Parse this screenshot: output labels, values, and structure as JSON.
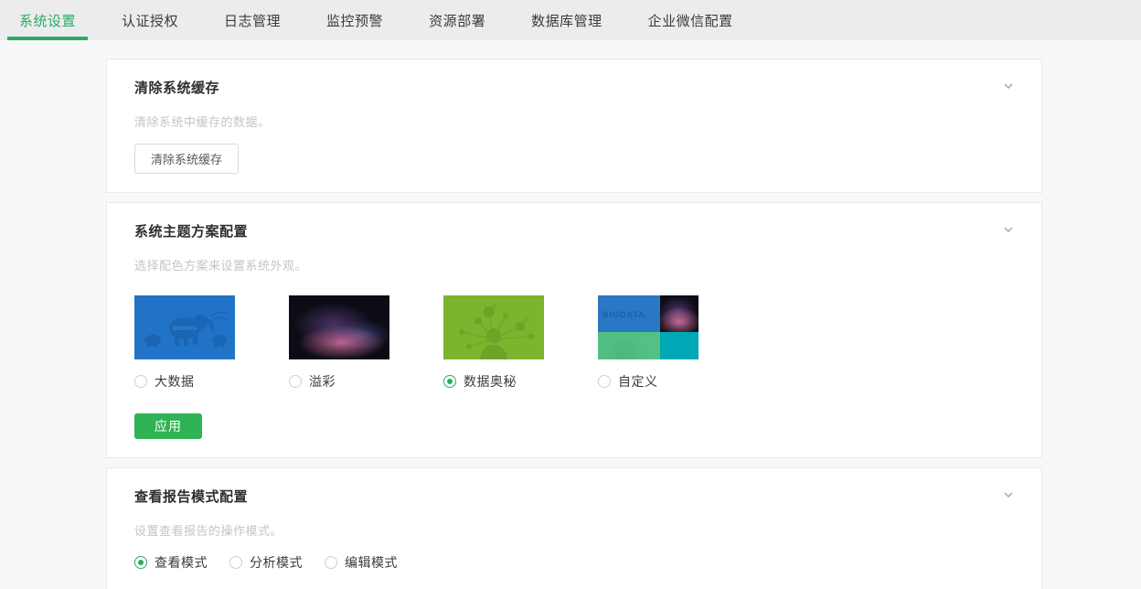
{
  "colors": {
    "accent_green": "#2bac63",
    "apply_button_green": "#2eb454",
    "tabbar_bg": "#ececee",
    "page_bg": "#f7f8fa",
    "theme_bigdata_blue": "#2173c8",
    "theme_aurora_bg": "#0c0c15",
    "theme_mystery_green": "#7cb42e",
    "theme_custom_emerald": "#53c183",
    "theme_custom_teal": "#00a7b4"
  },
  "tabs": [
    {
      "label": "系统设置",
      "active": true
    },
    {
      "label": "认证授权",
      "active": false
    },
    {
      "label": "日志管理",
      "active": false
    },
    {
      "label": "监控预警",
      "active": false
    },
    {
      "label": "资源部署",
      "active": false
    },
    {
      "label": "数据库管理",
      "active": false
    },
    {
      "label": "企业微信配置",
      "active": false
    }
  ],
  "cards": {
    "clear_cache": {
      "title": "清除系统缓存",
      "description": "清除系统中缓存的数据。",
      "button_label": "清除系统缓存"
    },
    "theme": {
      "title": "系统主题方案配置",
      "description": "选择配色方案来设置系统外观。",
      "art_text": "BIGDATA",
      "options": [
        {
          "label": "大数据",
          "selected": false
        },
        {
          "label": "溢彩",
          "selected": false
        },
        {
          "label": "数据奥秘",
          "selected": true
        },
        {
          "label": "自定义",
          "selected": false
        }
      ],
      "apply_label": "应用"
    },
    "report_mode": {
      "title": "查看报告模式配置",
      "description": "设置查看报告的操作模式。",
      "options": [
        {
          "label": "查看模式",
          "selected": true
        },
        {
          "label": "分析模式",
          "selected": false
        },
        {
          "label": "编辑模式",
          "selected": false
        }
      ]
    }
  }
}
